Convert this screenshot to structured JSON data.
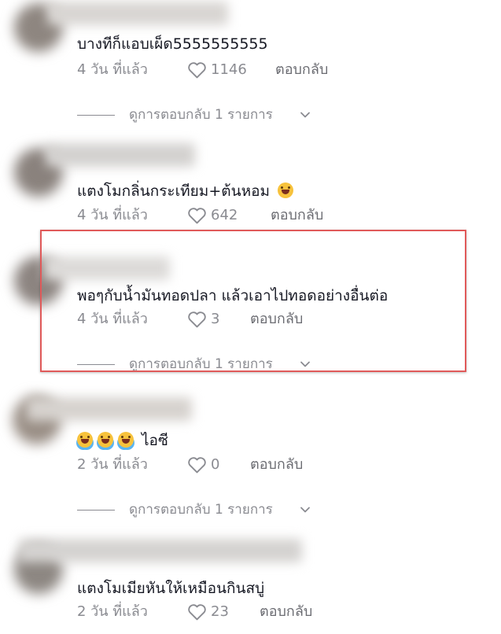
{
  "colors": {
    "text": "#161823",
    "meta": "#8a8b91",
    "highlight": "#e05a5a"
  },
  "comments": [
    {
      "text": "บางทีก็แอบเผ็ด5555555555",
      "time": "4 วัน ที่แล้ว",
      "likes": "1146",
      "reply": "ตอบกลับ",
      "view_replies": "ดูการตอบกลับ 1 รายการ"
    },
    {
      "text": "แตงโมกลิ่นกระเทียม+ต้นหอม",
      "emoji": "sweat-smile-emoji",
      "time": "4 วัน ที่แล้ว",
      "likes": "642",
      "reply": "ตอบกลับ"
    },
    {
      "text": "พอๆกับน้ำมันทอดปลา แล้วเอาไปทอดอย่างอื่นต่อ",
      "time": "4 วัน ที่แล้ว",
      "likes": "3",
      "reply": "ตอบกลับ",
      "view_replies": "ดูการตอบกลับ 1 รายการ",
      "highlighted": true
    },
    {
      "text": "ไอซี",
      "emoji": "tears-of-joy-emoji",
      "emoji_count": 3,
      "time": "2 วัน ที่แล้ว",
      "likes": "0",
      "reply": "ตอบกลับ",
      "view_replies": "ดูการตอบกลับ 1 รายการ"
    },
    {
      "text": "แตงโมเมียหันให้เหมือนกินสบู่",
      "time": "2 วัน ที่แล้ว",
      "likes": "23",
      "reply": "ตอบกลับ"
    }
  ]
}
